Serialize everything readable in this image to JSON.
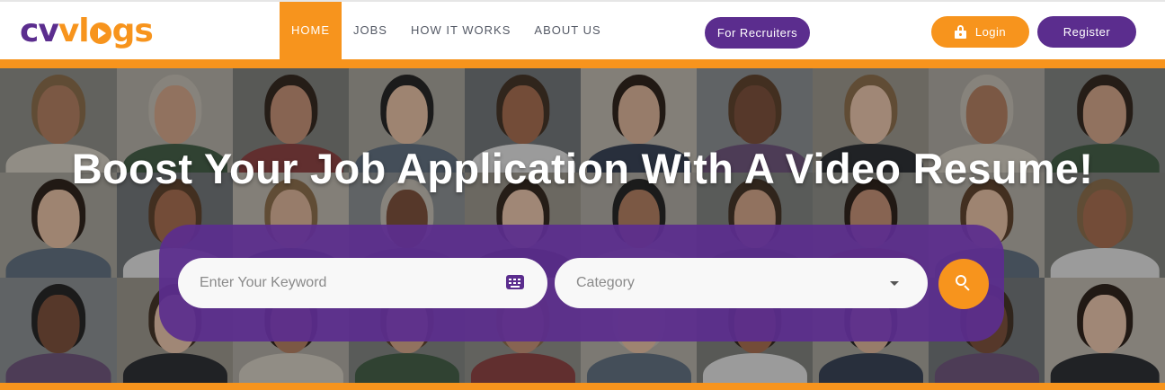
{
  "header": {
    "logo": {
      "part1": "cv",
      "part2": "vl",
      "part3": "gs"
    },
    "nav": [
      {
        "label": "HOME",
        "active": true
      },
      {
        "label": "JOBS",
        "active": false
      },
      {
        "label": "HOW IT WORKS",
        "active": false
      },
      {
        "label": "ABOUT US",
        "active": false
      }
    ],
    "recruiters_label": "For Recruiters",
    "login_label": "Login",
    "register_label": "Register"
  },
  "hero": {
    "title": "Boost Your Job Application With A Video Resume!",
    "search": {
      "keyword_placeholder": "Enter Your Keyword",
      "keyword_icon": "keyboard-icon",
      "category_label": "Category",
      "category_icon": "caret-down-icon",
      "submit_icon": "search-icon"
    }
  },
  "colors": {
    "brand_purple": "#5b2d8e",
    "brand_orange": "#f7941d",
    "nav_text": "#555a66",
    "white": "#ffffff"
  }
}
